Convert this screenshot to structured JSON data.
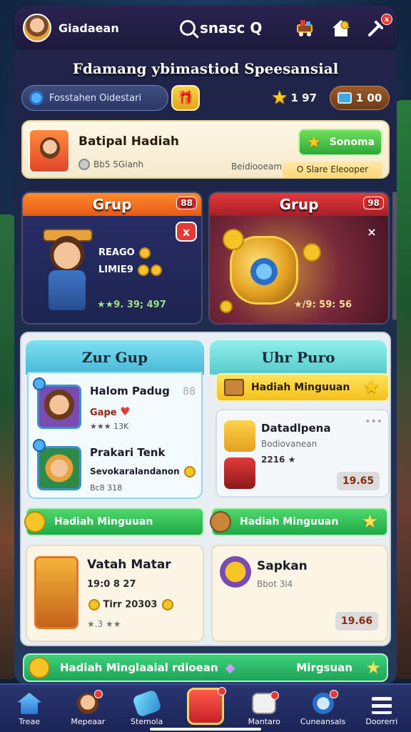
{
  "header": {
    "player_name": "Giadaean",
    "search_label": "snasc Q",
    "icons": [
      "cart-icon",
      "home-icon",
      "tools-icon"
    ],
    "tools_badge": "x"
  },
  "headline": "Fdamang ybimastiod Speesansial",
  "toolbar": {
    "filter_label": "Fosstahen Oidestari",
    "stars": "1 97",
    "coins": "1 00"
  },
  "banner": {
    "title": "Batipal Hadiah",
    "sub": "Bb5 5Gianh",
    "mid": "Beidiooeam",
    "button_label": "Sonoma",
    "pill_label": "O Slare Eleooper"
  },
  "grup_cards": [
    {
      "title": "Grup",
      "badge": "88",
      "close": "x",
      "line1": "REAGO",
      "line2": "LIMIE9",
      "stats": "★★9. 39; 497"
    },
    {
      "title": "Grup",
      "badge": "98",
      "close": "×",
      "stats": "★/9: 59: 56"
    }
  ],
  "left_column": {
    "title": "Zur Gup",
    "friends": [
      {
        "name": "Halom Padug",
        "sub": "Gape",
        "meta": "★★★ 13K",
        "flag": "88"
      },
      {
        "name": "Prakari Tenk",
        "sub": "Sevokaralandanon",
        "meta": "Bc8 318"
      }
    ],
    "weekly_label": "Hadiah Minguuan",
    "lower": {
      "title": "Vatah Matar",
      "line1": "19:0 8 27",
      "line2": "Tirr 20303",
      "meta": "★.3 ★★"
    }
  },
  "right_column": {
    "title": "Uhr Puro",
    "weekly_label": "Hadiah Minguuan",
    "item": {
      "name": "Datadlpena",
      "sub": "Bodiovanean",
      "meta": "2216 ★",
      "price": "19.65"
    },
    "weekly_label_2": "Hadiah Minguuan",
    "lower": {
      "title": "Sapkan",
      "meta": "Bbot 3l4",
      "price": "19.66"
    }
  },
  "bottom_strip": {
    "label": "Hadiah Minglaaial rdioean",
    "right_label": "Mirgsuan"
  },
  "nav": [
    {
      "label": "Treae",
      "icon": "home-icon"
    },
    {
      "label": "Mepeaar",
      "icon": "profile-icon"
    },
    {
      "label": "Stemola",
      "icon": "rocket-icon"
    },
    {
      "label": "",
      "icon": "gift-icon"
    },
    {
      "label": "Mantaro",
      "icon": "dice-icon"
    },
    {
      "label": "Cuneansals",
      "icon": "clock-icon"
    },
    {
      "label": "Doorerri",
      "icon": "menu-icon"
    }
  ],
  "colors": {
    "accent_green": "#2fa83a",
    "accent_gold": "#f6c427",
    "badge_red": "#e53935"
  }
}
